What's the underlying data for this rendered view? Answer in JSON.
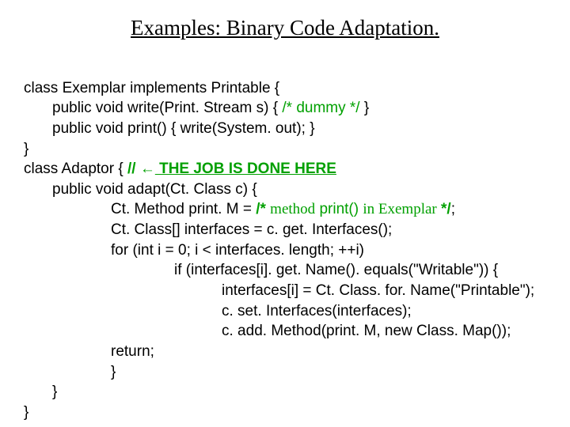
{
  "title": "Examples: Binary Code Adaptation.",
  "code": {
    "l1": "class Exemplar implements Printable {",
    "l2": "public void write(Print. Stream s) { ",
    "l2c": "/* dummy */",
    "l2b": " }",
    "l3": "public void print() { write(System. out); }",
    "l4": "}",
    "l5": "class Adaptor { ",
    "l5a": "// ",
    "l5arrow": "←",
    "l5b": " THE JOB IS DONE HERE",
    "l6": "public void adapt(Ct. Class c) {",
    "l7": "Ct. Method print. M = ",
    "l7a": "/* ",
    "l7b": "method",
    "l7c": " print() ",
    "l7d": "in Exemplar",
    "l7e": " */",
    "l7f": ";",
    "l8": "Ct. Class[] interfaces = c. get. Interfaces();",
    "l9": "for (int i = 0; i < interfaces. length; ++i)",
    "l10": "if (interfaces[i]. get. Name(). equals(\"Writable\")) {",
    "l11": "interfaces[i] = Ct. Class. for. Name(\"Printable\");",
    "l12": "c. set. Interfaces(interfaces);",
    "l13": "c. add. Method(print. M, new Class. Map());",
    "l14": "return;",
    "l15": "}",
    "l16": "}",
    "l17": "}"
  }
}
